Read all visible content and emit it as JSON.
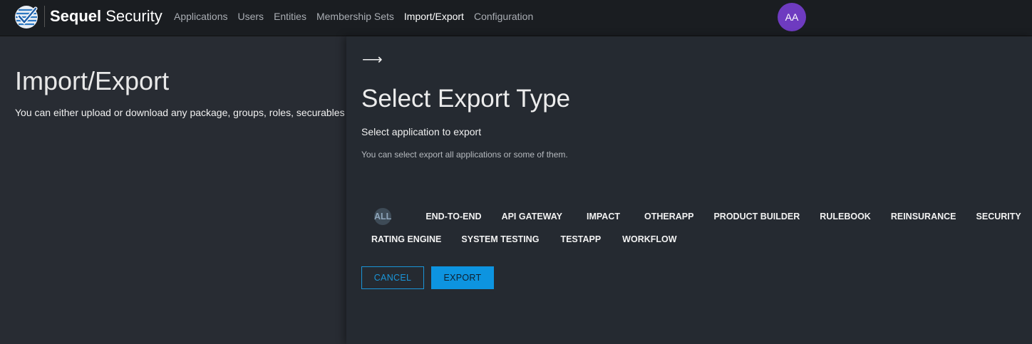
{
  "header": {
    "brand_bold": "Sequel",
    "brand_light": " Security",
    "logo_icon": "checkmark-globe-logo",
    "nav": [
      {
        "label": "Applications",
        "active": false
      },
      {
        "label": "Users",
        "active": false
      },
      {
        "label": "Entities",
        "active": false
      },
      {
        "label": "Membership Sets",
        "active": false
      },
      {
        "label": "Import/Export",
        "active": true
      },
      {
        "label": "Configuration",
        "active": false
      }
    ],
    "avatar_initials": "AA",
    "avatar_color": "#6e3bc0"
  },
  "page": {
    "title": "Import/Export",
    "description": "You can either upload or download any package, groups, roles, securables"
  },
  "panel": {
    "back_icon": "arrow-right-icon",
    "title": "Select Export Type",
    "subtitle": "Select application to export",
    "hint": "You can select export all applications or some of them.",
    "apps_row1": [
      "ALL",
      "END-TO-END",
      "API GATEWAY",
      "IMPACT",
      "OTHERAPP",
      "PRODUCT BUILDER",
      "RULEBOOK",
      "REINSURANCE",
      "SECURITY"
    ],
    "apps_row2": [
      "RATING ENGINE",
      "SYSTEM TESTING",
      "TESTAPP",
      "WORKFLOW"
    ],
    "selected_app": "ALL",
    "cancel_label": "CANCEL",
    "export_label": "EXPORT",
    "accent_color": "#0d94e0"
  }
}
